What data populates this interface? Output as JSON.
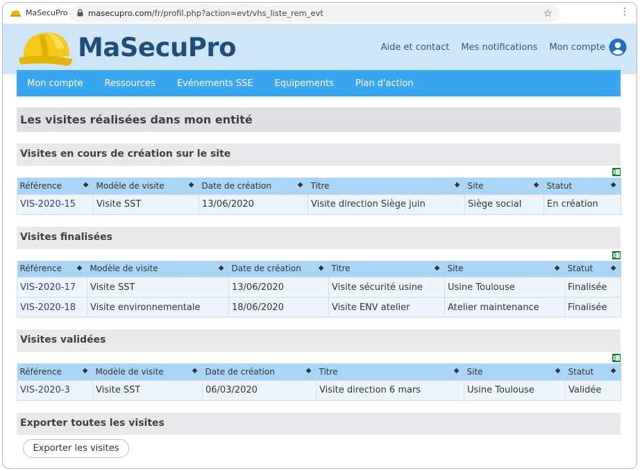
{
  "browser": {
    "tab_title": "MaSecuPro",
    "url_domain": "masecupro.com",
    "url_path": "/fr/profil.php?action=evt/vhs_liste_rem_evt"
  },
  "header": {
    "brand": "MaSecuPro",
    "links": [
      "Aide et contact",
      "Mes notifications",
      "Mon compte"
    ]
  },
  "nav": [
    "Mon compte",
    "Ressources",
    "Evénements SSE",
    "Equipements",
    "Plan d'action"
  ],
  "page_title": "Les visites réalisées dans mon entité",
  "sections": [
    {
      "title": "Visites en cours de création sur le site",
      "columns": [
        "Référence",
        "Modèle de visite",
        "Date de création",
        "Titre",
        "Site",
        "Statut"
      ],
      "rows": [
        [
          "VIS-2020-15",
          "Visite SST",
          "13/06/2020",
          "Visite direction Siège juin",
          "Siège social",
          "En création"
        ]
      ]
    },
    {
      "title": "Visites finalisées",
      "columns": [
        "Référence",
        "Modèle de visite",
        "Date de création",
        "Titre",
        "Site",
        "Statut"
      ],
      "rows": [
        [
          "VIS-2020-17",
          "Visite SST",
          "13/06/2020",
          "Visite sécurité usine",
          "Usine Toulouse",
          "Finalisée"
        ],
        [
          "VIS-2020-18",
          "Visite environnementale",
          "18/06/2020",
          "Visite ENV atelier",
          "Atelier maintenance",
          "Finalisée"
        ]
      ]
    },
    {
      "title": "Visites validées",
      "columns": [
        "Référence",
        "Modèle de visite",
        "Date de création",
        "Titre",
        "Site",
        "Statut"
      ],
      "rows": [
        [
          "VIS-2020-3",
          "Visite SST",
          "06/03/2020",
          "Visite direction 6 mars",
          "Usine Toulouse",
          "Validée"
        ]
      ]
    }
  ],
  "export": {
    "title": "Exporter toutes les visites",
    "button_label": "Exporter les visites"
  },
  "icons": {
    "sort": "sort-icon",
    "excel": "excel-export-icon",
    "user": "user-account-icon",
    "helmet": "helmet-logo"
  },
  "colors": {
    "header_bg": "#cfe6f8",
    "nav_bg": "#39a6f2",
    "table_header_bg": "#a9d5f7",
    "row_bg": "#eef4fc"
  }
}
